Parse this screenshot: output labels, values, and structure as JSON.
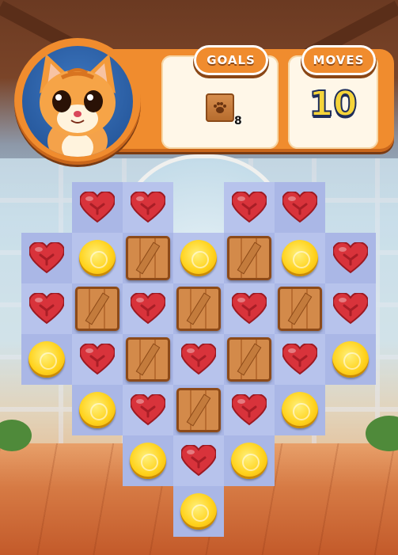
{
  "hud": {
    "goals_label": "GOALS",
    "moves_label": "MOVES",
    "moves_value": "10",
    "goal": {
      "icon": "paw-crate-icon",
      "count": "8"
    }
  },
  "colors": {
    "hud_orange": "#f08c2e",
    "tile": "#b7c3ec",
    "border": "#f3b43e",
    "moves_text": "#f5d43a"
  },
  "board": {
    "rows": [
      [
        null,
        "heart",
        "heart",
        null,
        "heart",
        "heart",
        null
      ],
      [
        "heart",
        "coin",
        "crate",
        "coin",
        "crate",
        "coin",
        "heart"
      ],
      [
        "heart",
        "crate",
        "heart",
        "crate",
        "heart",
        "crate",
        "heart"
      ],
      [
        "coin",
        "heart",
        "crate",
        "heart",
        "crate",
        "heart",
        "coin"
      ],
      [
        null,
        "coin",
        "heart",
        "crate",
        "heart",
        "coin",
        null
      ],
      [
        null,
        null,
        "coin",
        "heart",
        "coin",
        null,
        null
      ],
      [
        null,
        null,
        null,
        "coin",
        null,
        null,
        null
      ]
    ]
  }
}
